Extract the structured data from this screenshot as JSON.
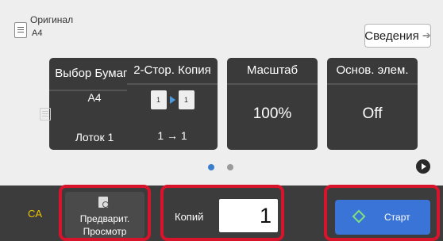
{
  "original": {
    "label": "Оригинал",
    "size": "A4",
    "icon": "document-icon"
  },
  "details_button": {
    "label": "Сведения",
    "icon": "arrow-right-icon"
  },
  "tiles": [
    {
      "title": "Выбор Бумаги",
      "size": "A4",
      "icon": "paper-tray-icon",
      "value": "Лоток 1"
    },
    {
      "title": "2-Стор. Копия",
      "icon": "duplex-copy-icon",
      "value": "1 → 1"
    },
    {
      "title": "Масштаб",
      "value": "100%"
    },
    {
      "title": "Основ. элем.",
      "value": "Off"
    }
  ],
  "pager": {
    "pages": 2,
    "current": 1,
    "next_icon": "next-page-icon"
  },
  "bottom": {
    "ca_label": "CA",
    "preview_label_line1": "Предварит.",
    "preview_label_line2": "Просмотр",
    "preview_icon": "preview-icon",
    "copies_label": "Копий",
    "copies_value": "1",
    "start_label": "Старт",
    "start_icon": "start-diamond-icon"
  },
  "colors": {
    "accent": "#3b74d7",
    "highlight": "#d7142c",
    "ca": "#f0c400",
    "tile": "#3a3a3a"
  }
}
